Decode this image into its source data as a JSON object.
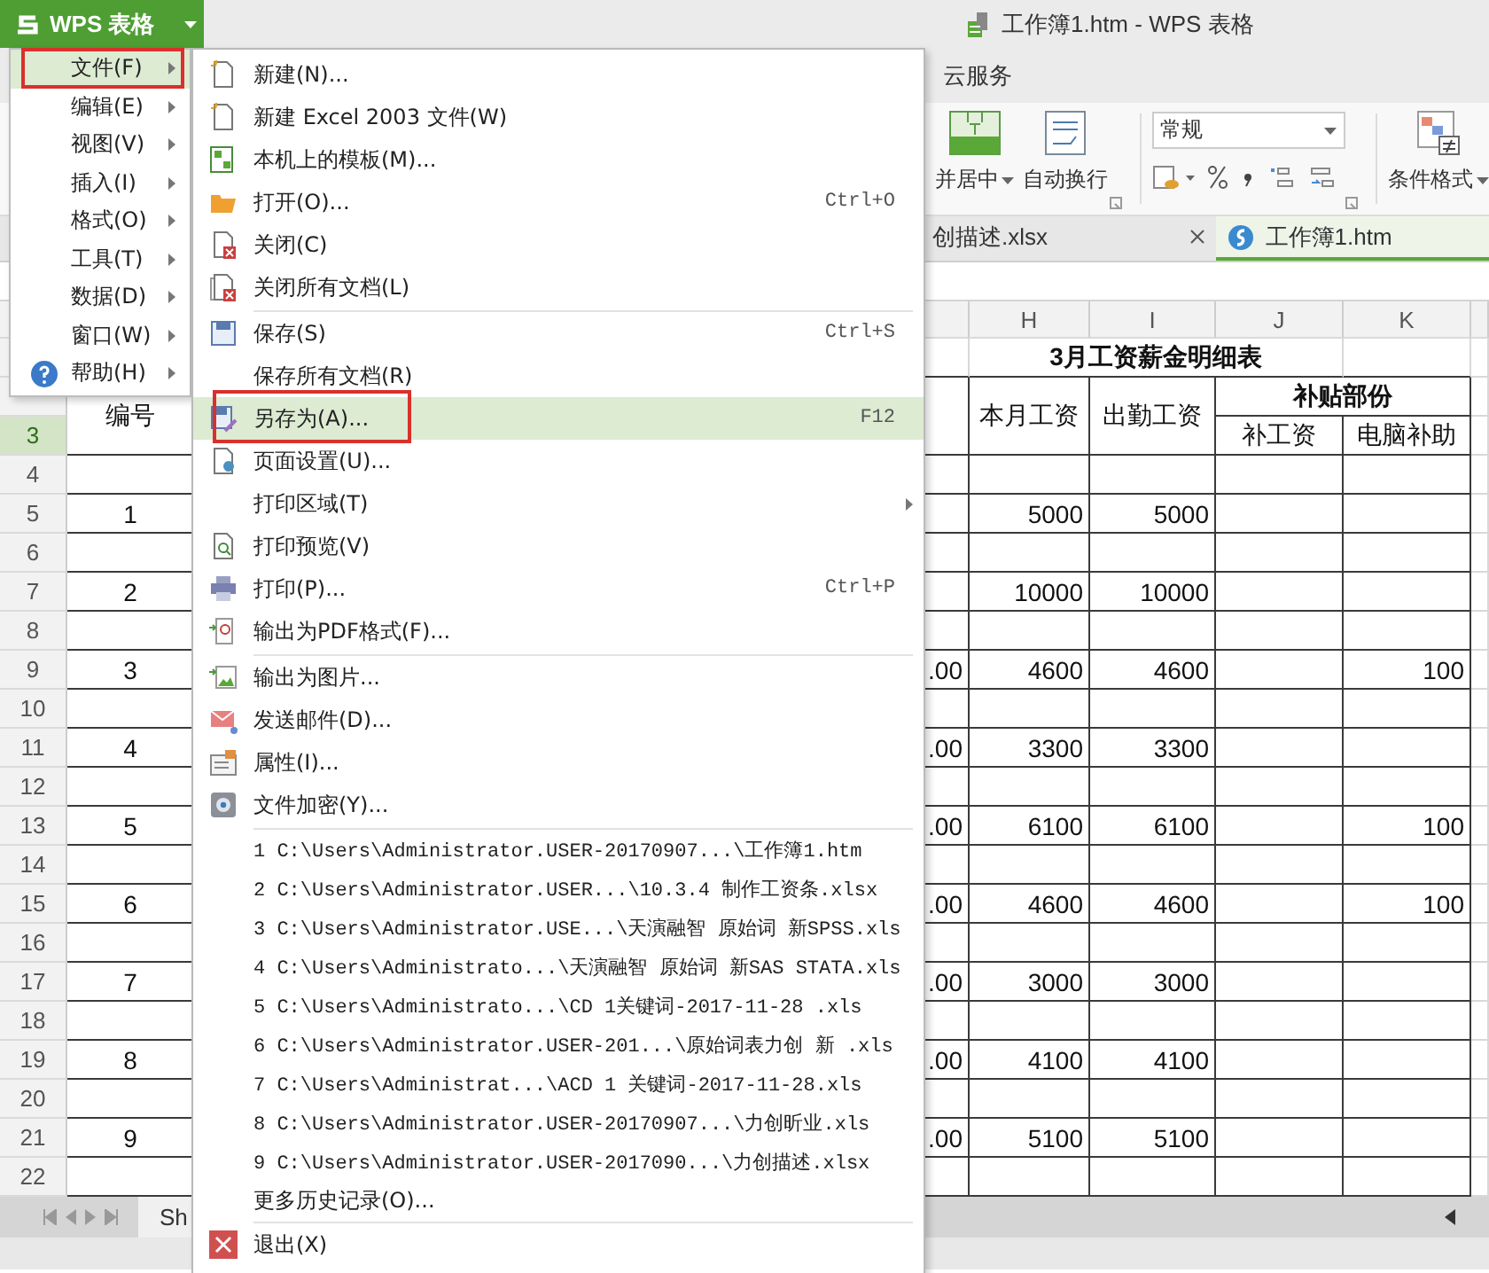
{
  "app_button": {
    "label": "WPS 表格"
  },
  "window": {
    "title": "工作簿1.htm - WPS 表格"
  },
  "menu_tabs": [
    {
      "label": "云服务"
    }
  ],
  "ribbon": {
    "merge": "并居中",
    "wrap": "自动换行",
    "number_format": "常规",
    "conditional_format": "条件格式"
  },
  "doc_tabs": [
    {
      "label": "创描述.xlsx",
      "selected": false
    },
    {
      "label": "工作簿1.htm",
      "selected": true
    }
  ],
  "sheet": {
    "columns": [
      "H",
      "I",
      "J",
      "K"
    ],
    "row_numbers": [
      {
        "label": "3",
        "selected": true
      },
      {
        "label": "4",
        "selected": false
      },
      {
        "label": "5",
        "selected": false
      },
      {
        "label": "6",
        "selected": false
      },
      {
        "label": "7",
        "selected": false
      },
      {
        "label": "8",
        "selected": false
      },
      {
        "label": "9",
        "selected": false
      },
      {
        "label": "10",
        "selected": false
      },
      {
        "label": "11",
        "selected": false
      },
      {
        "label": "12",
        "selected": false
      },
      {
        "label": "13",
        "selected": false
      },
      {
        "label": "14",
        "selected": false
      },
      {
        "label": "15",
        "selected": false
      },
      {
        "label": "16",
        "selected": false
      },
      {
        "label": "17",
        "selected": false
      },
      {
        "label": "18",
        "selected": false
      },
      {
        "label": "19",
        "selected": false
      },
      {
        "label": "20",
        "selected": false
      },
      {
        "label": "21",
        "selected": false
      },
      {
        "label": "22",
        "selected": false
      }
    ],
    "title": "3月工资薪金明细表",
    "headers": {
      "number": "编号",
      "pay": "本月工资",
      "attendance": "出勤工资",
      "allowance": "补贴部份",
      "allowance_parts": [
        "补工资",
        "电脑补助"
      ]
    },
    "records": [
      {
        "no": "1",
        "pay": "5000",
        "attendance": "5000"
      },
      {
        "no": "2",
        "pay": "10000",
        "attendance": "10000"
      },
      {
        "no": "3",
        "column_g": ".00",
        "pay": "4600",
        "attendance": "4600",
        "computer": "100"
      },
      {
        "no": "4",
        "column_g": ".00",
        "pay": "3300",
        "attendance": "3300"
      },
      {
        "no": "5",
        "column_g": ".00",
        "pay": "6100",
        "attendance": "6100",
        "computer": "100"
      },
      {
        "no": "6",
        "column_g": ".00",
        "pay": "4600",
        "attendance": "4600",
        "computer": "100"
      },
      {
        "no": "7",
        "column_g": ".00",
        "pay": "3000",
        "attendance": "3000"
      },
      {
        "no": "8",
        "column_g": ".00",
        "pay": "4100",
        "attendance": "4100"
      },
      {
        "no": "9",
        "column_g": ".00",
        "pay": "5100",
        "attendance": "5100"
      }
    ]
  },
  "sheet_tabs": [
    {
      "label": "Sh"
    }
  ],
  "app_menu": {
    "items": [
      {
        "label": "文件(F)",
        "selected": true,
        "submenu": true
      },
      {
        "label": "编辑(E)",
        "selected": false,
        "submenu": true
      },
      {
        "label": "视图(V)",
        "selected": false,
        "submenu": true
      },
      {
        "label": "插入(I)",
        "selected": false,
        "submenu": true
      },
      {
        "label": "格式(O)",
        "selected": false,
        "submenu": true
      },
      {
        "label": "工具(T)",
        "selected": false,
        "submenu": true
      },
      {
        "label": "数据(D)",
        "selected": false,
        "submenu": true
      },
      {
        "label": "窗口(W)",
        "selected": false,
        "submenu": true
      },
      {
        "label": "帮助(H)",
        "selected": false,
        "submenu": true
      }
    ]
  },
  "file_menu": {
    "groups": [
      {
        "items": [
          {
            "kind": "command",
            "label": "新建(N)...",
            "selected": false,
            "submenu": false
          },
          {
            "kind": "command",
            "label": "新建 Excel 2003 文件(W)",
            "selected": false,
            "submenu": false
          },
          {
            "kind": "command",
            "label": "本机上的模板(M)...",
            "selected": false,
            "submenu": false
          },
          {
            "kind": "command",
            "label": "打开(O)...",
            "shortcut": "Ctrl+O",
            "selected": false,
            "submenu": false
          },
          {
            "kind": "command",
            "label": "关闭(C)",
            "selected": false,
            "submenu": false
          },
          {
            "kind": "command",
            "label": "关闭所有文档(L)",
            "selected": false,
            "submenu": false
          }
        ]
      },
      {
        "items": [
          {
            "kind": "command",
            "label": "保存(S)",
            "shortcut": "Ctrl+S",
            "selected": false,
            "submenu": false
          },
          {
            "kind": "command",
            "label": "保存所有文档(R)",
            "selected": false,
            "submenu": false
          },
          {
            "kind": "command",
            "label": "另存为(A)...",
            "shortcut": "F12",
            "selected": true,
            "submenu": false
          },
          {
            "kind": "command",
            "label": "页面设置(U)...",
            "selected": false,
            "submenu": false
          },
          {
            "kind": "command",
            "label": "打印区域(T)",
            "selected": false,
            "submenu": true
          },
          {
            "kind": "command",
            "label": "打印预览(V)",
            "selected": false,
            "submenu": false
          },
          {
            "kind": "command",
            "label": "打印(P)...",
            "shortcut": "Ctrl+P",
            "selected": false,
            "submenu": false
          },
          {
            "kind": "command",
            "label": "输出为PDF格式(F)...",
            "selected": false,
            "submenu": false
          }
        ]
      },
      {
        "items": [
          {
            "kind": "command",
            "label": "输出为图片...",
            "selected": false,
            "submenu": false
          },
          {
            "kind": "command",
            "label": "发送邮件(D)...",
            "selected": false,
            "submenu": false
          },
          {
            "kind": "command",
            "label": "属性(I)...",
            "selected": false,
            "submenu": false
          },
          {
            "kind": "command",
            "label": "文件加密(Y)...",
            "selected": false,
            "submenu": false
          }
        ]
      },
      {
        "items": [
          {
            "kind": "recent",
            "label": "1 C:\\Users\\Administrator.USER-20170907...\\工作簿1.htm",
            "selected": false,
            "submenu": false
          },
          {
            "kind": "recent",
            "label": "2 C:\\Users\\Administrator.USER...\\10.3.4 制作工资条.xlsx",
            "selected": false,
            "submenu": false
          },
          {
            "kind": "recent",
            "label": "3 C:\\Users\\Administrator.USE...\\天演融智 原始词 新SPSS.xls",
            "selected": false,
            "submenu": false
          },
          {
            "kind": "recent",
            "label": "4 C:\\Users\\Administrato...\\天演融智 原始词 新SAS STATA.xls",
            "selected": false,
            "submenu": false
          },
          {
            "kind": "recent",
            "label": "5 C:\\Users\\Administrato...\\CD 1关键词-2017-11-28 .xls",
            "selected": false,
            "submenu": false
          },
          {
            "kind": "recent",
            "label": "6 C:\\Users\\Administrator.USER-201...\\原始词表力创 新 .xls",
            "selected": false,
            "submenu": false
          },
          {
            "kind": "recent",
            "label": "7 C:\\Users\\Administrat...\\ACD 1 关键词-2017-11-28.xls",
            "selected": false,
            "submenu": false
          },
          {
            "kind": "recent",
            "label": "8 C:\\Users\\Administrator.USER-20170907...\\力创昕业.xls",
            "selected": false,
            "submenu": false
          },
          {
            "kind": "recent",
            "label": "9 C:\\Users\\Administrator.USER-2017090...\\力创描述.xlsx",
            "selected": false,
            "submenu": false
          },
          {
            "kind": "more",
            "label": "更多历史记录(O)...",
            "selected": false,
            "submenu": false
          }
        ]
      },
      {
        "items": [
          {
            "kind": "command",
            "label": "退出(X)",
            "selected": false,
            "submenu": false
          }
        ]
      }
    ]
  }
}
